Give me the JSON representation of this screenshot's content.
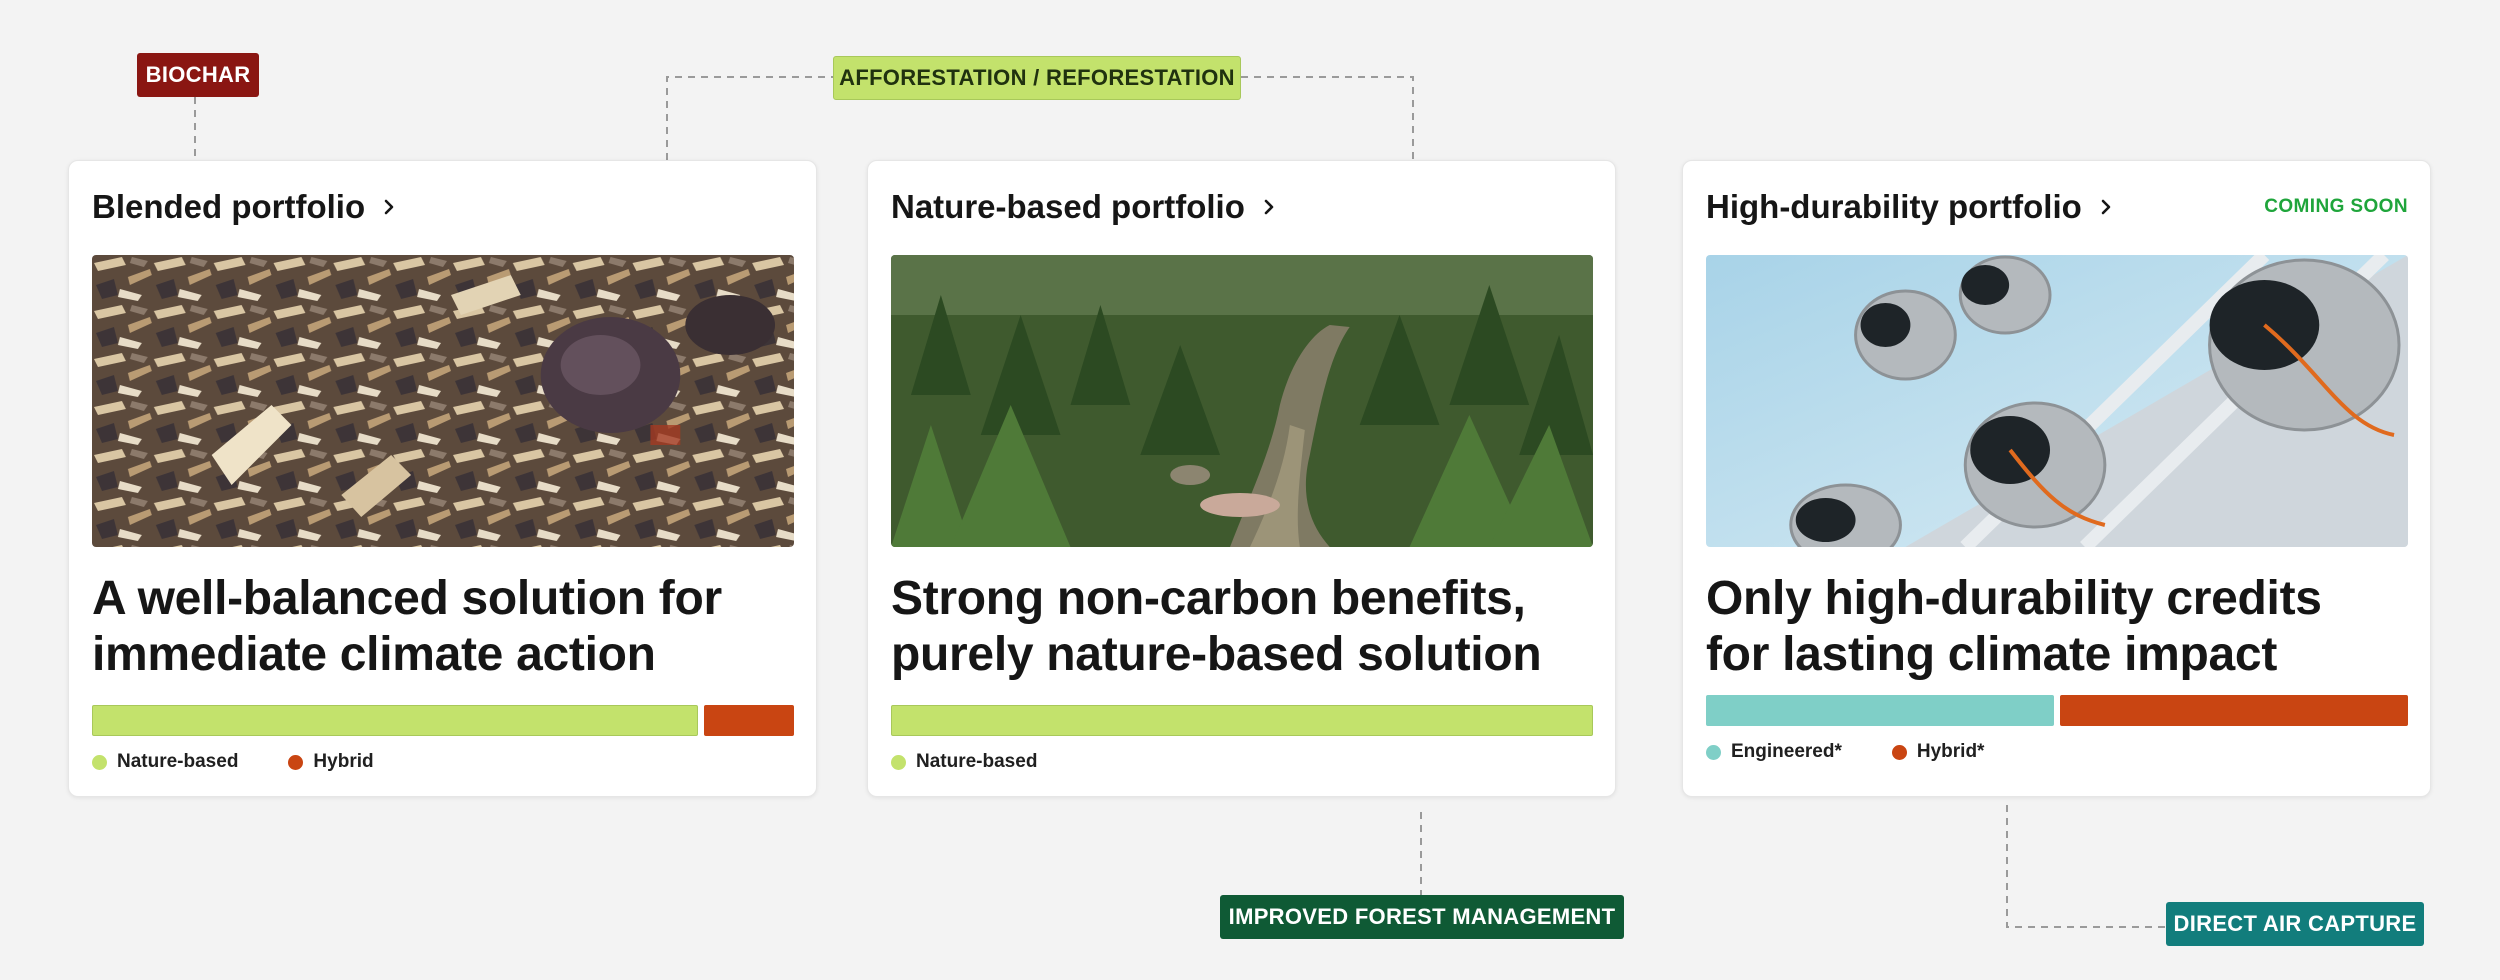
{
  "tags": {
    "biochar": "BIOCHAR",
    "afforestation": "AFFORESTATION / REFORESTATION",
    "ifm": "IMPROVED FOREST MANAGEMENT",
    "dac": "DIRECT AIR CAPTURE"
  },
  "colors": {
    "nature_based": "#c3e26c",
    "hybrid": "#c94512",
    "engineered": "#7fcfc7",
    "coming_soon": "#1fa53b",
    "biochar_tag": "#8a1612",
    "ifm_tag": "#0f5a35",
    "dac_tag": "#127d7c"
  },
  "cards": [
    {
      "title": "Blended portfolio",
      "badge": "",
      "image_icon": "biochar-image",
      "headline_line1": "A well-balanced solution for",
      "headline_line2": "immediate climate action",
      "mix": [
        {
          "label": "Nature-based",
          "share": 0.866,
          "color": "#c3e26c"
        },
        {
          "label": "Hybrid",
          "share": 0.134,
          "color": "#c94512"
        }
      ]
    },
    {
      "title": "Nature-based portfolio",
      "badge": "",
      "image_icon": "forest-river-image",
      "headline_line1": "Strong non-carbon benefits,",
      "headline_line2": "purely nature-based solution",
      "mix": [
        {
          "label": "Nature-based",
          "share": 1.0,
          "color": "#c3e26c"
        }
      ]
    },
    {
      "title": "High-durability portfolio",
      "badge": "COMING SOON",
      "image_icon": "direct-air-capture-image",
      "headline_line1": "Only high-durability credits",
      "headline_line2": "for lasting climate impact",
      "mix": [
        {
          "label": "Engineered*",
          "share": 0.5,
          "color": "#7fcfc7"
        },
        {
          "label": "Hybrid*",
          "share": 0.5,
          "color": "#c94512"
        }
      ]
    }
  ]
}
